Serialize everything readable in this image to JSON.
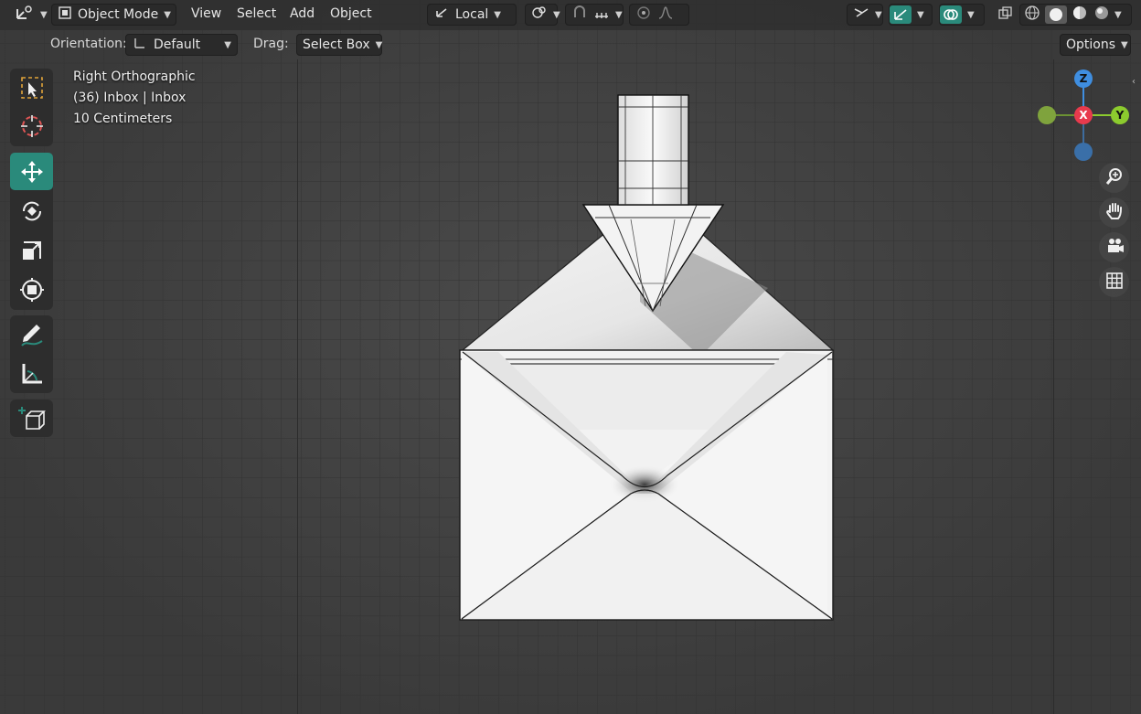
{
  "header": {
    "editor_type_icon": "axes-icon",
    "mode": "Object Mode",
    "menus": [
      "View",
      "Select",
      "Add",
      "Object"
    ],
    "orientation_global": "Local",
    "icons": [
      "snap-icon",
      "snap-increment-icon",
      "proportional-edit-icon",
      "falloff-icon",
      "visibility-icon",
      "gizmo-icon",
      "overlay-icon",
      "xray-icon",
      "wireframe-icon",
      "solid-icon",
      "material-icon",
      "rendered-icon"
    ]
  },
  "tool_settings": {
    "orientation_label": "Orientation:",
    "orientation_value": "Default",
    "drag_label": "Drag:",
    "drag_value": "Select Box",
    "options": "Options"
  },
  "overlay": {
    "view_name": "Right Orthographic",
    "collection": "(36) Inbox | Inbox",
    "scale": "10 Centimeters"
  },
  "tools": [
    "select-box-tool",
    "cursor-tool",
    "move-tool",
    "rotate-tool",
    "scale-tool",
    "transform-tool",
    "annotate-tool",
    "measure-tool",
    "add-cube-tool"
  ],
  "active_tool": "move-tool",
  "gizmo": {
    "z": "Z",
    "x": "X",
    "y": "Y"
  },
  "colors": {
    "accent": "#2a8a7b",
    "axis_x": "#e83a4d",
    "axis_y": "#8ccb2e",
    "axis_z": "#3f8ee0"
  }
}
